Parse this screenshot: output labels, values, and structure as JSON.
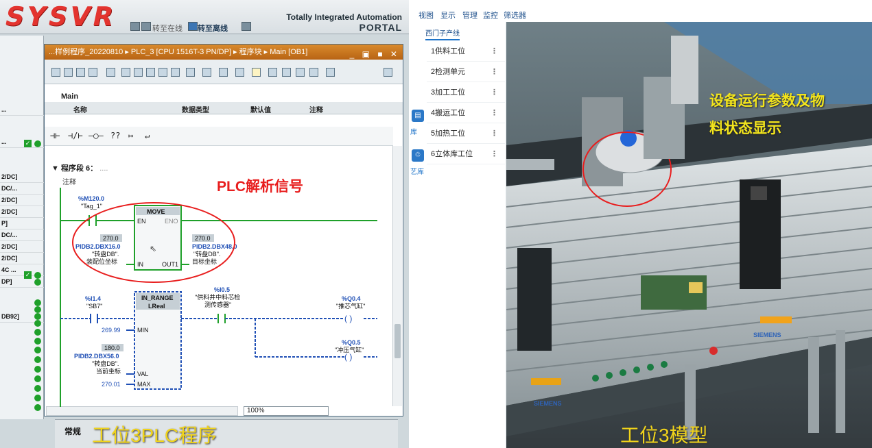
{
  "left_app": {
    "logo": "SYSVR",
    "title_line1": "Totally Integrated Automation",
    "title_line2": "PORTAL",
    "toolbar": {
      "go_online": "转至在线",
      "go_offline": "转至离线"
    },
    "tree_rows": [
      "...",
      "...",
      "2/DC]",
      "DC/...",
      "2/DC]",
      "2/DC]",
      "P]",
      "DC/...",
      "2/DC]",
      "2/DC]",
      "4C ...",
      "DP]",
      "",
      "",
      "",
      "DB92]"
    ],
    "editor": {
      "title": "...样例程序_20220810 ▸ PLC_3 [CPU 1516T-3 PN/DP] ▸ 程序块 ▸ Main [OB1]",
      "block_name": "Main",
      "columns": [
        "名称",
        "数据类型",
        "默认值",
        "注释"
      ],
      "ladder_toolbar": [
        "⊣⊢",
        "⊣/⊢",
        "–◯–",
        "??",
        "↦",
        "↵"
      ],
      "segment": "程序段 6：",
      "segment_more": "....",
      "comment": "注释",
      "move_block": {
        "name": "MOVE",
        "en": "EN",
        "eno": "ENO",
        "in": "IN",
        "out": "OUT1",
        "contact_addr": "%M120.0",
        "contact_tag": "\"Tag_1\"",
        "in_value": "270.0",
        "in_addr": "PIDB2.DBX16.0",
        "in_tag1": "\"转盘DB\".",
        "in_tag2": "装配位坐标",
        "out_value": "270.0",
        "out_addr": "PIDB2.DBX48.0",
        "out_tag1": "\"转盘DB\".",
        "out_tag2": "目标坐标"
      },
      "range_block": {
        "name": "IN_RANGE",
        "type": "LReal",
        "min": "MIN",
        "val": "VAL",
        "max": "MAX",
        "contact1_addr": "%I1.4",
        "contact1_tag": "\"SB7\"",
        "contact2_addr": "%I0.5",
        "contact2_tag1": "\"供料井中料芯检",
        "contact2_tag2": "测传感器\"",
        "coil1_addr": "%Q0.4",
        "coil1_tag": "\"推芯气缸\"",
        "coil2_addr": "%Q0.5",
        "coil2_tag": "\"冲压气缸\"",
        "min_value": "269.99",
        "val_value": "180.0",
        "val_addr": "PIDB2.DBX56.0",
        "val_tag1": "\"转盘DB\".",
        "val_tag2": "当前坐标",
        "max_value": "270.01"
      },
      "zoom": "100%"
    },
    "bottom_tab": "常规",
    "annotation": "PLC解析信号",
    "caption": "工位3PLC程序"
  },
  "right_app": {
    "menu": [
      "视图",
      "显示",
      "管理",
      "监控",
      "筛选器"
    ],
    "panel_tab": "西门子产线",
    "stations": [
      "1供料工位",
      "2检测单元",
      "3加工工位",
      "4搬运工位",
      "5加热工位",
      "6立体库工位"
    ],
    "side_labels": [
      "库",
      "艺库"
    ],
    "annotation_line1": "设备运行参数及物",
    "annotation_line2": "料状态显示",
    "caption": "工位3模型",
    "brand": "SIEMENS"
  },
  "colors": {
    "accent_red": "#e3342f",
    "caption_yellow": "#f1d41b",
    "annotation_red": "#e81e1e",
    "ladder_green": "#1fa02a",
    "ladder_blue": "#1f4fb5",
    "editor_title_orange": "#c97420"
  }
}
